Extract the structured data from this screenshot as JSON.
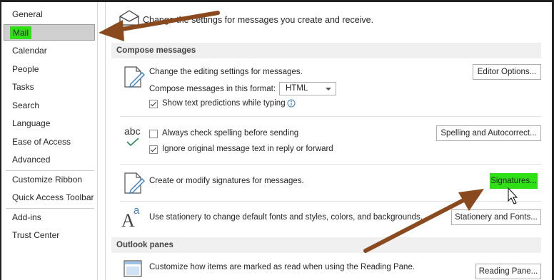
{
  "sidebar": {
    "items": [
      {
        "label": "General"
      },
      {
        "label": "Mail"
      },
      {
        "label": "Calendar"
      },
      {
        "label": "People"
      },
      {
        "label": "Tasks"
      },
      {
        "label": "Search"
      },
      {
        "label": "Language"
      },
      {
        "label": "Ease of Access"
      },
      {
        "label": "Advanced"
      },
      {
        "label": "Customize Ribbon"
      },
      {
        "label": "Quick Access Toolbar"
      },
      {
        "label": "Add-ins"
      },
      {
        "label": "Trust Center"
      }
    ],
    "selected": "Mail"
  },
  "main": {
    "header": "Change the settings for messages you create and receive.",
    "compose": {
      "title": "Compose messages",
      "editing_text": "Change the editing settings for messages.",
      "editor_button": "Editor Options...",
      "format_label": "Compose messages in this format:",
      "format_value": "HTML",
      "show_predictions": "Show text predictions while typing",
      "spell_icon_text": "abc",
      "always_check": "Always check spelling before sending",
      "spelling_button": "Spelling and Autocorrect...",
      "ignore_original": "Ignore original message text in reply or forward",
      "signatures_text": "Create or modify signatures for messages.",
      "signatures_button": "Signatures...",
      "stationery_text": "Use stationery to change default fonts and styles, colors, and backgrounds.",
      "stationery_button": "Stationery and Fonts..."
    },
    "panes": {
      "title": "Outlook panes",
      "reading_text": "Customize how items are marked as read when using the Reading Pane.",
      "reading_button": "Reading Pane..."
    }
  },
  "colors": {
    "highlight": "#2fe014",
    "arrow": "#8a4a1e",
    "selected_bg": "#cfcfcf",
    "section_bg": "#f0f0f0"
  }
}
